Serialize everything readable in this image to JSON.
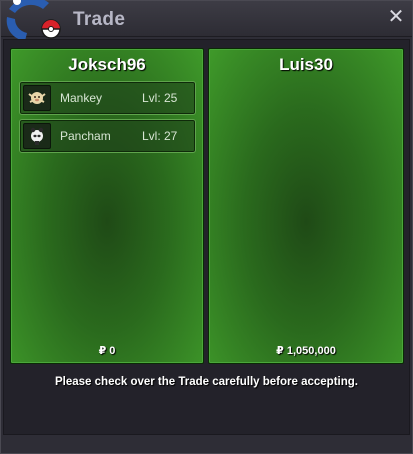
{
  "window": {
    "title": "Trade",
    "close_glyph": "✕",
    "icons": {
      "logo": "pokeball-logo-icon",
      "close": "close-icon"
    },
    "colors": {
      "panel_green": "#2a6a1d",
      "title_text": "#b7b7c6"
    }
  },
  "left": {
    "player": "Joksch96",
    "pokemon": [
      {
        "name": "Mankey",
        "level": "Lvl: 25",
        "icon": "mankey-icon"
      },
      {
        "name": "Pancham",
        "level": "Lvl: 27",
        "icon": "pancham-icon"
      }
    ],
    "money": "₽ 0"
  },
  "right": {
    "player": "Luis30",
    "pokemon": [],
    "money": "₽ 1,050,000"
  },
  "footer": {
    "notice": "Please check over the Trade carefully before accepting."
  }
}
